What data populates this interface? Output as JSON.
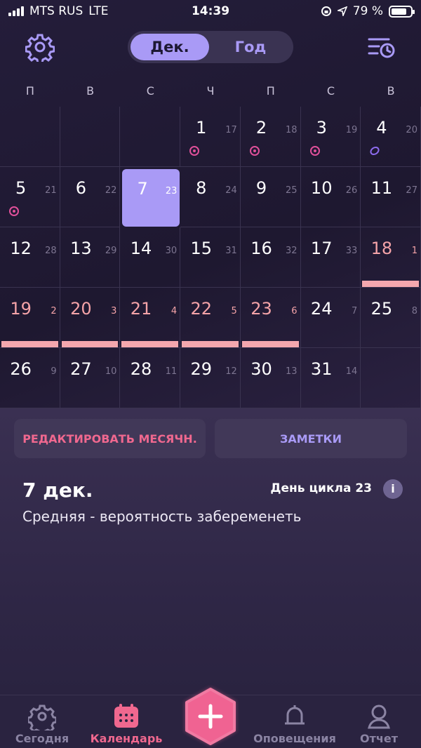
{
  "status": {
    "carrier": "MTS RUS",
    "network": "LTE",
    "time": "14:39",
    "battery": "79 %"
  },
  "header": {
    "month_tab": "Дек.",
    "year_tab": "Год"
  },
  "weekdays": [
    "П",
    "В",
    "С",
    "Ч",
    "П",
    "С",
    "В"
  ],
  "calendar": {
    "cells": [
      {
        "day": "",
        "cycle": ""
      },
      {
        "day": "",
        "cycle": ""
      },
      {
        "day": "",
        "cycle": ""
      },
      {
        "day": "1",
        "cycle": "17",
        "mark": "ovulation"
      },
      {
        "day": "2",
        "cycle": "18",
        "mark": "ovulation"
      },
      {
        "day": "3",
        "cycle": "19",
        "mark": "ovulation"
      },
      {
        "day": "4",
        "cycle": "20",
        "mark": "egg"
      },
      {
        "day": "5",
        "cycle": "21",
        "mark": "ovulation"
      },
      {
        "day": "6",
        "cycle": "22"
      },
      {
        "day": "7",
        "cycle": "23",
        "selected": true
      },
      {
        "day": "8",
        "cycle": "24"
      },
      {
        "day": "9",
        "cycle": "25"
      },
      {
        "day": "10",
        "cycle": "26"
      },
      {
        "day": "11",
        "cycle": "27"
      },
      {
        "day": "12",
        "cycle": "28"
      },
      {
        "day": "13",
        "cycle": "29"
      },
      {
        "day": "14",
        "cycle": "30"
      },
      {
        "day": "15",
        "cycle": "31"
      },
      {
        "day": "16",
        "cycle": "32"
      },
      {
        "day": "17",
        "cycle": "33"
      },
      {
        "day": "18",
        "cycle": "1",
        "period": true
      },
      {
        "day": "19",
        "cycle": "2",
        "period": true
      },
      {
        "day": "20",
        "cycle": "3",
        "period": true
      },
      {
        "day": "21",
        "cycle": "4",
        "period": true
      },
      {
        "day": "22",
        "cycle": "5",
        "period": true
      },
      {
        "day": "23",
        "cycle": "6",
        "period": true
      },
      {
        "day": "24",
        "cycle": "7"
      },
      {
        "day": "25",
        "cycle": "8"
      },
      {
        "day": "26",
        "cycle": "9"
      },
      {
        "day": "27",
        "cycle": "10"
      },
      {
        "day": "28",
        "cycle": "11"
      },
      {
        "day": "29",
        "cycle": "12"
      },
      {
        "day": "30",
        "cycle": "13"
      },
      {
        "day": "31",
        "cycle": "14"
      },
      {
        "day": "",
        "cycle": ""
      }
    ]
  },
  "actions": {
    "edit_period": "РЕДАКТИРОВАТЬ МЕСЯЧН.",
    "notes": "ЗАМЕТКИ"
  },
  "details": {
    "date": "7 дек.",
    "cycle_day": "День цикла 23",
    "chance": "Средняя - вероятность забеременеть"
  },
  "tabs": [
    {
      "label": "Сегодня",
      "icon": "gear-icon"
    },
    {
      "label": "Календарь",
      "icon": "calendar-icon",
      "active": true
    },
    {
      "label": "Оповещения",
      "icon": "bell-icon"
    },
    {
      "label": "Отчет",
      "icon": "person-icon"
    }
  ],
  "colors": {
    "accent": "#a99af6",
    "period": "#f4a7ae",
    "pink": "#f0688f",
    "fab": "#f06392"
  }
}
